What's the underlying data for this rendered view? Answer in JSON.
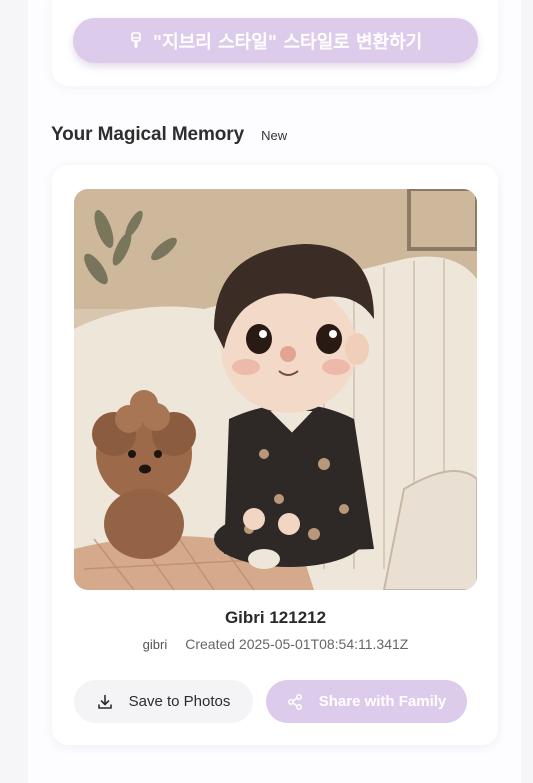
{
  "convert_section": {
    "convert_button_label": "\"지브리 스타일\" 스타일로 변환하기",
    "convert_icon": "brush-icon"
  },
  "memory_section": {
    "title": "Your Magical Memory",
    "badge": "New"
  },
  "memory_card": {
    "image_alt": "Illustrated child in pajamas sitting on a sofa next to a curly brown puppy",
    "name": "Gibri 121212",
    "style_tag": "gibri",
    "created_label": "Created 2025-05-01T08:54:11.341Z",
    "save_button_label": "Save to Photos",
    "save_icon": "download-icon",
    "share_button_label": "Share with Family",
    "share_icon": "share-icon"
  },
  "colors": {
    "accent_lavender": "#dccbea",
    "card_bg": "#ffffff",
    "page_bg": "#f6f5f8"
  }
}
